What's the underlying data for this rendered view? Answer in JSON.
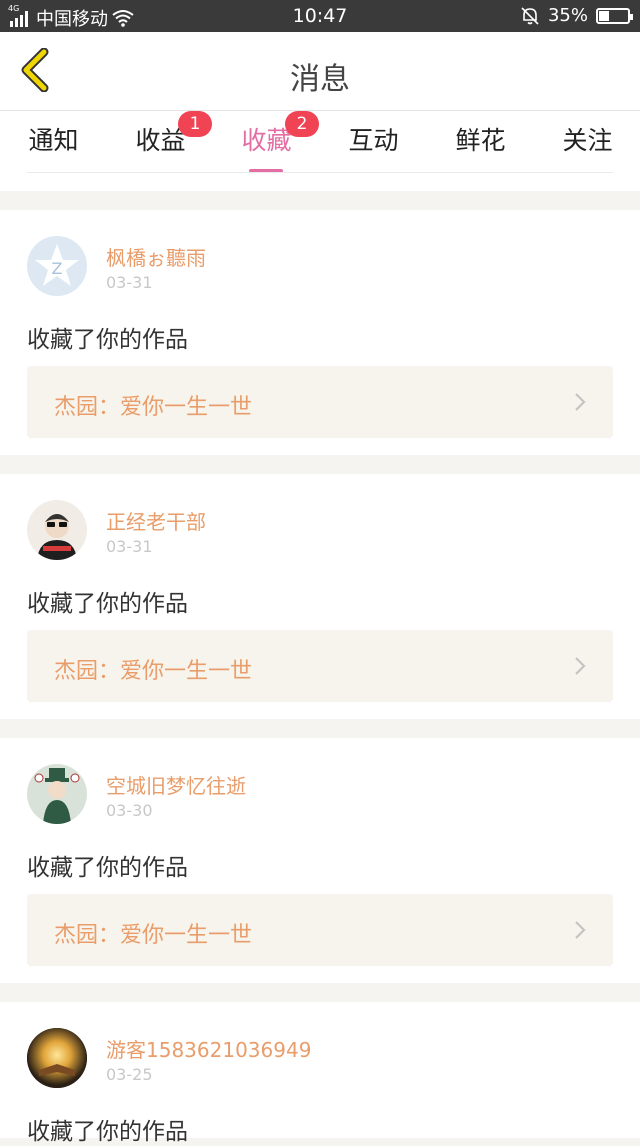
{
  "status_bar": {
    "network": "4G",
    "carrier": "中国移动",
    "time": "10:47",
    "battery": "35%",
    "battery_level": 0.35,
    "icons": [
      "signal-icon",
      "wifi-icon",
      "silent-bell-icon",
      "battery-icon"
    ]
  },
  "header": {
    "title": "消息",
    "back_icon": "chevron-left-icon",
    "accent": "#f0d600"
  },
  "tabs": [
    {
      "label": "通知",
      "badge": ""
    },
    {
      "label": "收益",
      "badge": "1"
    },
    {
      "label": "收藏",
      "badge": "2",
      "active": true
    },
    {
      "label": "互动",
      "badge": ""
    },
    {
      "label": "鲜花",
      "badge": ""
    },
    {
      "label": "关注",
      "badge": ""
    }
  ],
  "colors": {
    "active_tab": "#e46ea3",
    "badge": "#f04354",
    "username": "#e99d6a",
    "work_bg": "#f6f4ec"
  },
  "messages": [
    {
      "username": "枫橋ぉ聽雨",
      "date": "03-31",
      "action": "收藏了你的作品",
      "work_title": "杰园：爱你一生一世",
      "avatar": "qzone-star-avatar"
    },
    {
      "username": "正经老干部",
      "date": "03-31",
      "action": "收藏了你的作品",
      "work_title": "杰园：爱你一生一世",
      "avatar": "sunglasses-person-avatar"
    },
    {
      "username": "空城旧梦忆往逝",
      "date": "03-30",
      "action": "收藏了你的作品",
      "work_title": "杰园：爱你一生一世",
      "avatar": "anime-character-avatar"
    },
    {
      "username": "游客1583621036949",
      "date": "03-25",
      "action": "收藏了你的作品",
      "work_title": "",
      "avatar": "glowing-book-avatar"
    }
  ]
}
